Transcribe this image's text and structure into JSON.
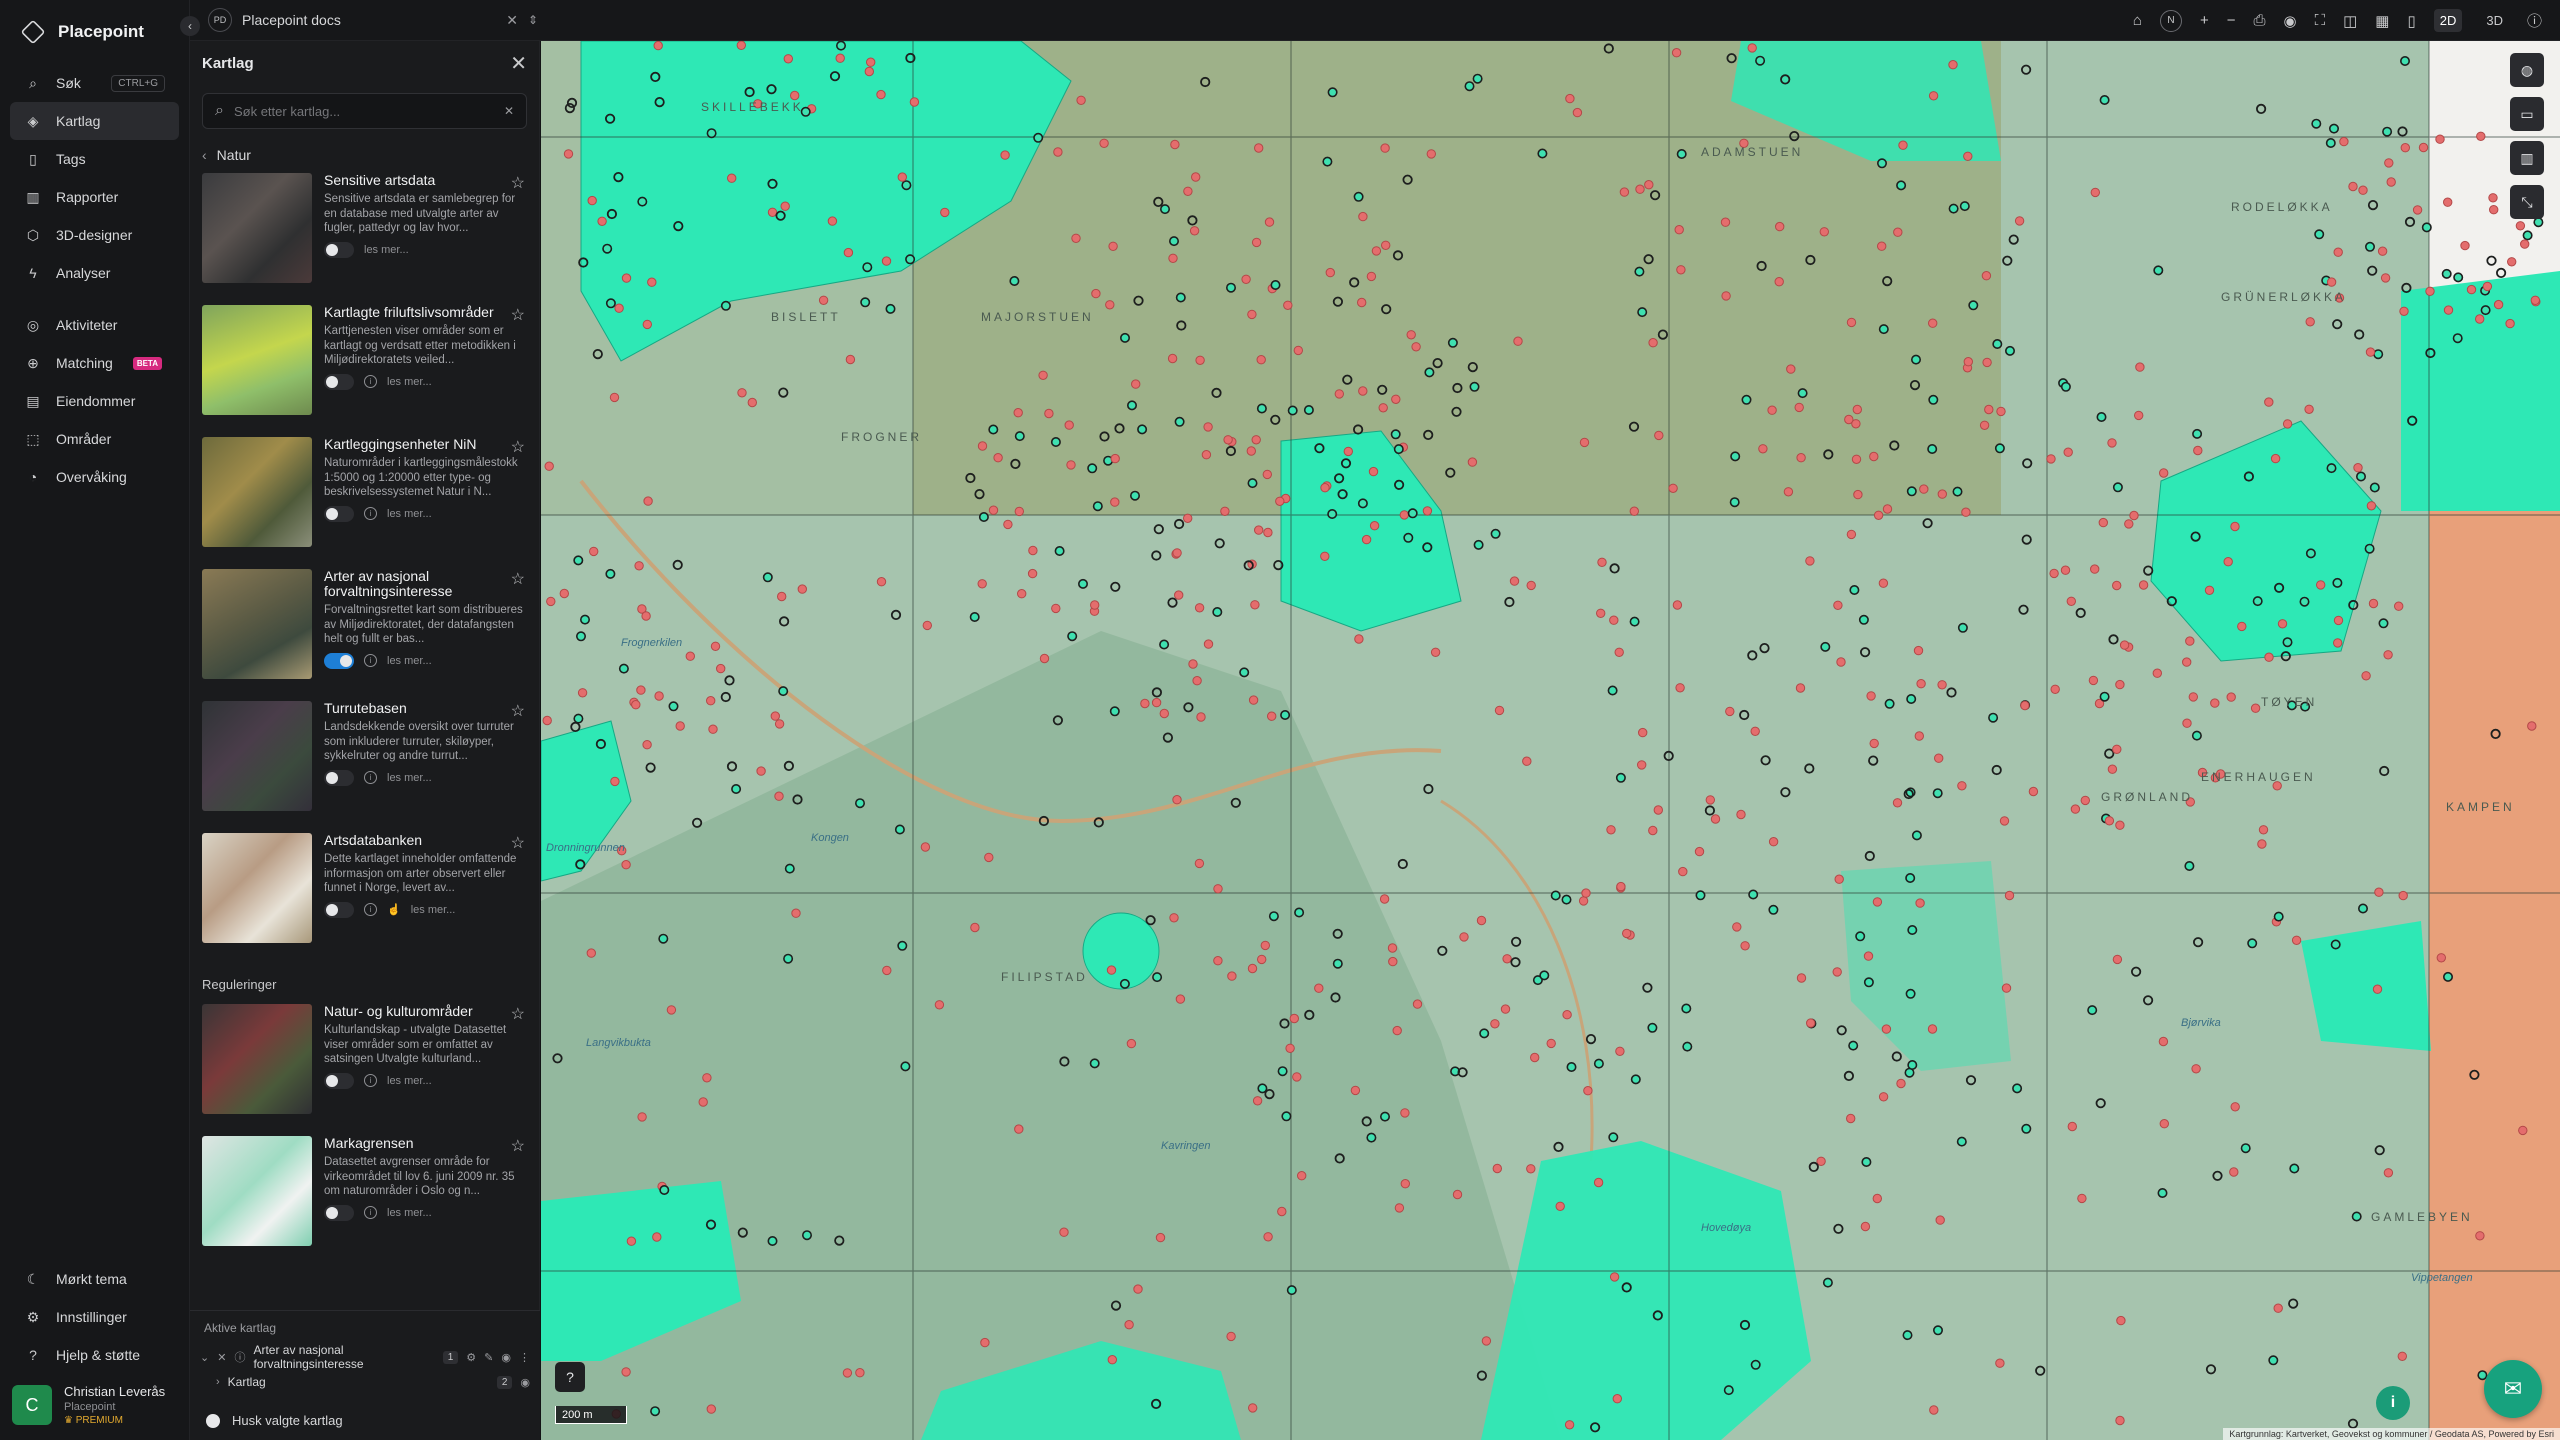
{
  "app": {
    "name": "Placepoint"
  },
  "nav": {
    "items": [
      {
        "label": "Søk",
        "shortcut": "CTRL+G",
        "icon": "search-icon"
      },
      {
        "label": "Kartlag",
        "icon": "layers-icon"
      },
      {
        "label": "Tags",
        "icon": "bookmark-icon"
      },
      {
        "label": "Rapporter",
        "icon": "chart-icon"
      },
      {
        "label": "3D-designer",
        "icon": "cube-icon"
      },
      {
        "label": "Analyser",
        "icon": "bolt-icon"
      },
      {
        "label": "Aktiviteter",
        "icon": "activity-icon"
      },
      {
        "label": "Matching",
        "badge": "BETA",
        "icon": "match-icon"
      },
      {
        "label": "Eiendommer",
        "icon": "building-icon"
      },
      {
        "label": "Områder",
        "icon": "area-icon"
      },
      {
        "label": "Overvåking",
        "icon": "monitor-icon"
      }
    ],
    "bottom": [
      {
        "label": "Mørkt tema",
        "icon": "moon-icon"
      },
      {
        "label": "Innstillinger",
        "icon": "gear-icon"
      },
      {
        "label": "Hjelp & støtte",
        "icon": "help-icon"
      }
    ],
    "user": {
      "initial": "C",
      "name": "Christian Leverås",
      "org": "Placepoint",
      "plan": "PREMIUM"
    }
  },
  "topbar": {
    "tab_badge": "PD",
    "tab_label": "Placepoint docs",
    "north": "N",
    "mode_2d": "2D",
    "mode_3d": "3D"
  },
  "panel": {
    "title": "Kartlag",
    "search_placeholder": "Søk etter kartlag...",
    "breadcrumb": "Natur",
    "read_more": "les mer...",
    "section_regulations": "Reguleringer",
    "layers": [
      {
        "title": "Sensitive artsdata",
        "desc": "Sensitive artsdata er samlebegrep for en database med utvalgte arter av fugler, pattedyr og lav hvor...",
        "on": false
      },
      {
        "title": "Kartlagte friluftslivsområder",
        "desc": "Karttjenesten viser områder som er kartlagt og verdsatt etter metodikken i Miljødirektoratets veiled...",
        "on": false
      },
      {
        "title": "Kartleggingsenheter NiN",
        "desc": "Naturområder i kartleggingsmålestokk 1:5000 og 1:20000 etter type- og beskrivelsessystemet Natur i N...",
        "on": false
      },
      {
        "title": "Arter av nasjonal forvaltningsinteresse",
        "desc": "Forvaltningsrettet kart som distribueres av Miljødirektoratet, der datafangsten helt og fullt er bas...",
        "on": true
      },
      {
        "title": "Turrutebasen",
        "desc": "Landsdekkende oversikt over turruter som inkluderer turruter, skiløyper, sykkelruter og andre turrut...",
        "on": false
      },
      {
        "title": "Artsdatabanken",
        "desc": "Dette kartlaget inneholder omfattende informasjon om arter observert eller funnet i Norge, levert av...",
        "on": false
      },
      {
        "title": "Natur- og kulturområder",
        "desc": "Kulturlandskap - utvalgte Datasettet viser områder som er omfattet av satsingen Utvalgte kulturland...",
        "on": false
      },
      {
        "title": "Markagrensen",
        "desc": "Datasettet avgrenser område for virkeområdet til lov 6. juni 2009 nr. 35 om naturområder i Oslo og n...",
        "on": false
      }
    ],
    "active": {
      "label": "Aktive kartlag",
      "layer_name": "Arter av nasjonal forvaltningsinteresse",
      "layer_count": "1",
      "group_name": "Kartlag",
      "group_count": "2",
      "remember": "Husk valgte kartlag"
    }
  },
  "map": {
    "scale": "200 m",
    "attribution": "Kartgrunnlag: Kartverket, Geovekst og kommuner / Geodata AS, Powered by Esri",
    "labels": [
      "SKILLEBEKK",
      "BISLETT",
      "FROGNER",
      "MAJORSTUEN",
      "ADAMSTUEN",
      "GRÜNERLØKKA",
      "RODELØKKA",
      "TØYEN",
      "GRØNLAND",
      "ENERHAUGEN",
      "KAMPEN",
      "GAMLEBYEN",
      "FILIPSTAD",
      "Frognerkilen",
      "Kongen",
      "Dronningrunnen",
      "Langvikbukta",
      "Kavringen",
      "Hovedøya",
      "Bjørvika",
      "Vippetangen"
    ],
    "colors": {
      "base": "#a6c4ae",
      "teal": "#2ee8b5",
      "olive": "#9bab7c",
      "orange": "#e8a07a",
      "point_red": "#e46d6d",
      "point_dark": "#1d1f1e"
    }
  }
}
